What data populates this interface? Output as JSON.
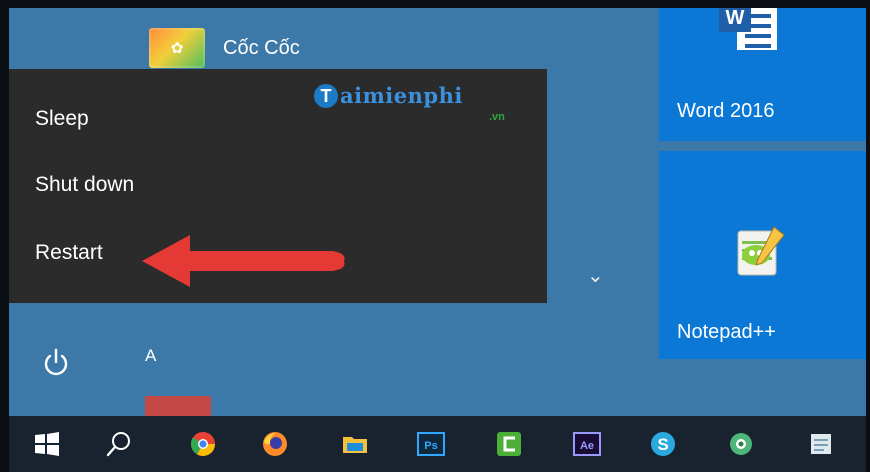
{
  "app_list": {
    "coccoc_label": "Cốc Cốc",
    "coccoc_icon": "coccoc-icon",
    "a_header": "A"
  },
  "power_menu": {
    "items": [
      "Sleep",
      "Shut down",
      "Restart"
    ],
    "annotation": "red-arrow-pointing-to-restart"
  },
  "watermark": {
    "initial": "T",
    "name": "aimienphi",
    "domain": ".vn"
  },
  "tiles": [
    {
      "label": "Word 2016",
      "icon": "word-icon"
    },
    {
      "label": "Notepad++",
      "icon": "notepad-plus-plus-icon"
    }
  ],
  "taskbar": {
    "buttons": [
      "start-windows-icon",
      "search-icon",
      "chrome-icon",
      "firefox-icon",
      "file-explorer-icon",
      "photoshop-icon",
      "camtasia-icon",
      "after-effects-icon",
      "skype-icon",
      "coccoc-taskbar-icon",
      "notepad-taskbar-icon"
    ],
    "ps_text": "Ps",
    "ae_text": "Ae",
    "word_glyph": "W"
  },
  "colors": {
    "start_bg": "#3d79a8",
    "menu_bg": "#2b2b2b",
    "tile_blue": "#0a78d4",
    "taskbar": "#18232f",
    "annotation_red": "#e53935"
  }
}
